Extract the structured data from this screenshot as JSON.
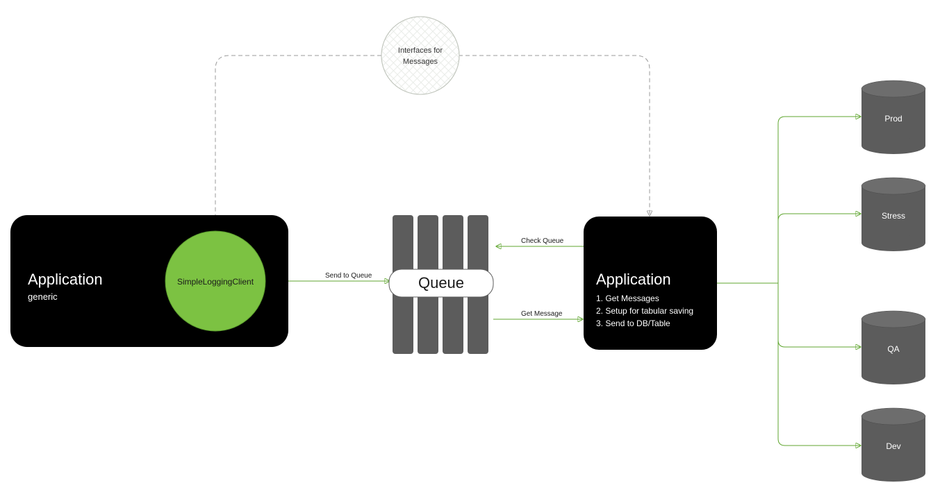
{
  "interfaces": {
    "line1": "Interfaces for",
    "line2": "Messages"
  },
  "app_left": {
    "title": "Application",
    "sub": "generic",
    "client": "SimpleLoggingClient"
  },
  "queue": {
    "label": "Queue"
  },
  "edges": {
    "send": "Send to Queue",
    "check": "Check Queue",
    "get": "Get Message"
  },
  "app_right": {
    "title": "Application",
    "l1": "1. Get Messages",
    "l2": "2. Setup for tabular saving",
    "l3": "3. Send to DB/Table"
  },
  "dbs": {
    "prod": "Prod",
    "stress": "Stress",
    "qa": "QA",
    "dev": "Dev"
  }
}
